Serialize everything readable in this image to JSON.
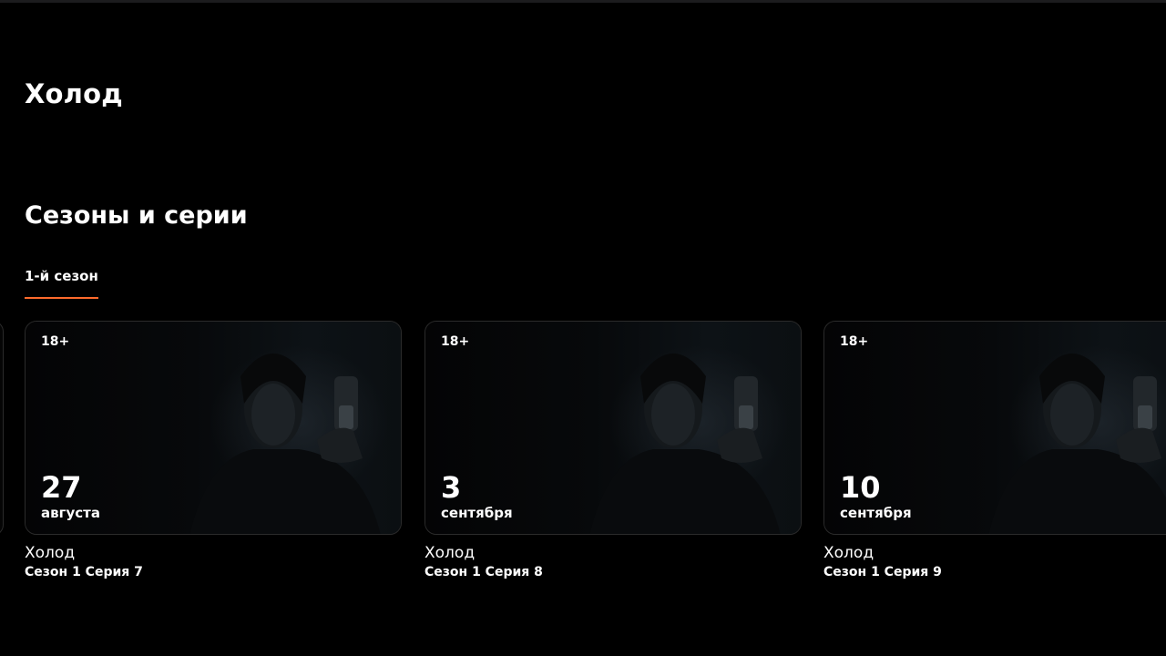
{
  "show": {
    "title": "Холод"
  },
  "seasons_section": {
    "title": "Сезоны и серии",
    "tabs": [
      {
        "label": "1-й сезон",
        "active": true
      }
    ]
  },
  "episodes": [
    {
      "age_rating": "18+",
      "day": "27",
      "month": "августа",
      "title": "Холод",
      "subtitle": "Сезон 1 Серия 7"
    },
    {
      "age_rating": "18+",
      "day": "3",
      "month": "сентября",
      "title": "Холод",
      "subtitle": "Сезон 1 Серия 8"
    },
    {
      "age_rating": "18+",
      "day": "10",
      "month": "сентября",
      "title": "Холод",
      "subtitle": "Сезон 1 Серия 9"
    }
  ],
  "colors": {
    "background": "#000000",
    "accent": "#ff6b2c",
    "text": "#ffffff",
    "card_border": "#2b2b2b"
  }
}
